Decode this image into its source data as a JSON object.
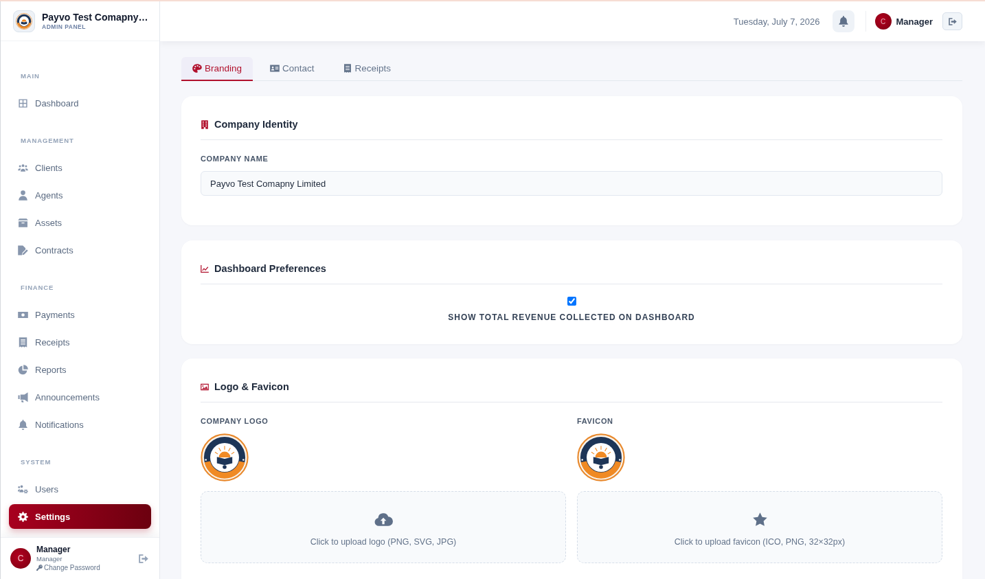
{
  "sidebar": {
    "brand": {
      "title": "Payvo Test Comapny…",
      "subtitle": "ADMIN PANEL"
    },
    "sections": [
      {
        "heading": "MAIN",
        "items": [
          {
            "label": "Dashboard",
            "selected": false
          }
        ]
      },
      {
        "heading": "MANAGEMENT",
        "items": [
          {
            "label": "Clients",
            "selected": false
          },
          {
            "label": "Agents",
            "selected": false
          },
          {
            "label": "Assets",
            "selected": false
          },
          {
            "label": "Contracts",
            "selected": false
          }
        ]
      },
      {
        "heading": "FINANCE",
        "items": [
          {
            "label": "Payments",
            "selected": false
          },
          {
            "label": "Receipts",
            "selected": false
          },
          {
            "label": "Reports",
            "selected": false
          },
          {
            "label": "Announcements",
            "selected": false
          },
          {
            "label": "Notifications",
            "selected": false
          }
        ]
      },
      {
        "heading": "SYSTEM",
        "items": [
          {
            "label": "Users",
            "selected": false
          },
          {
            "label": "Settings",
            "selected": true
          }
        ]
      }
    ],
    "user": {
      "initial": "C",
      "name": "Manager",
      "role": "Manager",
      "link": "Change Password"
    }
  },
  "topbar": {
    "date": "Tuesday, July 7, 2026",
    "user": {
      "initial": "C",
      "name": "Manager"
    }
  },
  "tabs": [
    {
      "label": "Branding",
      "selected": true
    },
    {
      "label": "Contact",
      "selected": false
    },
    {
      "label": "Receipts",
      "selected": false
    }
  ],
  "cards": [
    {
      "kind": "text-field",
      "title": "Company Identity",
      "field": {
        "label": "COMPANY NAME",
        "value": "Payvo Test Comapny Limited"
      }
    },
    {
      "kind": "checkbox",
      "title": "Dashboard Preferences",
      "option": {
        "label": "SHOW TOTAL REVENUE COLLECTED ON DASHBOARD",
        "checked": true
      }
    },
    {
      "kind": "uploads",
      "title": "Logo & Favicon",
      "uploads": [
        {
          "label": "COMPANY LOGO",
          "hint": "Click to upload logo (PNG, SVG, JPG)"
        },
        {
          "label": "FAVICON",
          "hint": "Click to upload favicon (ICO, PNG, 32×32px)"
        }
      ]
    }
  ]
}
